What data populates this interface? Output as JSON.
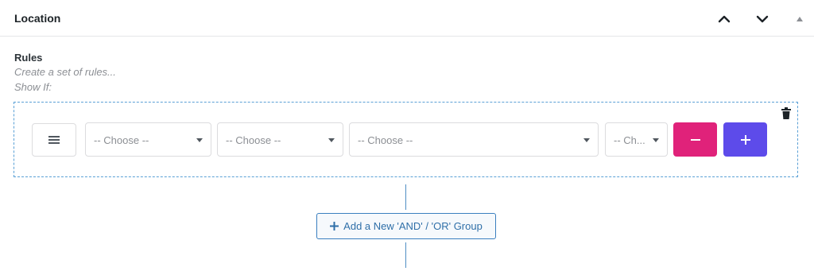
{
  "panel": {
    "title": "Location",
    "controls": [
      "chevron-up-icon",
      "chevron-down-icon",
      "triangle-up-icon"
    ]
  },
  "rules": {
    "label": "Rules",
    "description": "Create a set of rules...",
    "show_if": "Show If:"
  },
  "group": {
    "selects": [
      {
        "value": "-- Choose --"
      },
      {
        "value": "-- Choose --"
      },
      {
        "value": "-- Choose --"
      },
      {
        "value": "-- Ch..."
      }
    ],
    "remove_icon": "minus-icon",
    "add_icon": "plus-icon",
    "delete_icon": "trash-icon",
    "handle_icon": "hamburger-icon"
  },
  "add_group": {
    "label": "Add a New 'AND' / 'OR' Group",
    "icon": "plus-icon"
  },
  "colors": {
    "remove": "#e0227a",
    "add": "#5d4bea",
    "group_border": "#5aa0d6",
    "link": "#2f6fa8"
  }
}
